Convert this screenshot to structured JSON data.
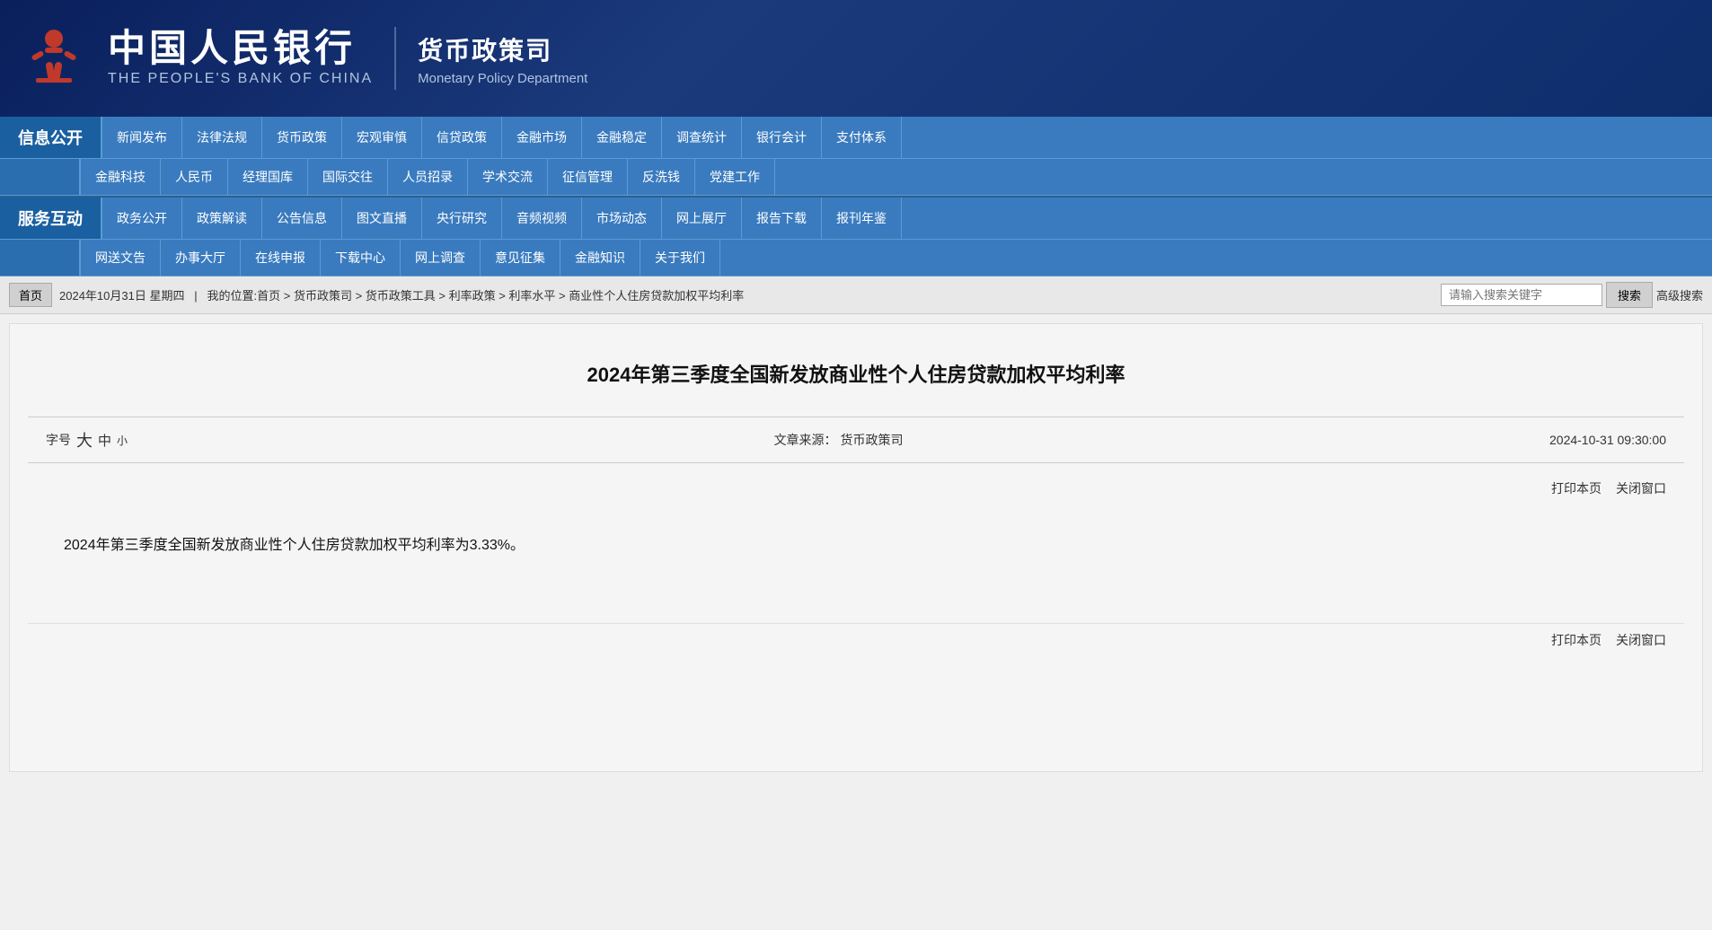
{
  "header": {
    "logo_chinese": "中国人民银行",
    "logo_english": "THE PEOPLE'S BANK OF CHINA",
    "dept_chinese": "货币政策司",
    "dept_english": "Monetary Policy Department"
  },
  "nav": {
    "row1": {
      "section_label": "信息公开",
      "items": [
        "新闻发布",
        "法律法规",
        "货币政策",
        "宏观审慎",
        "信贷政策",
        "金融市场",
        "金融稳定",
        "调查统计",
        "银行会计",
        "支付体系"
      ]
    },
    "row2": {
      "items": [
        "金融科技",
        "人民币",
        "经理国库",
        "国际交往",
        "人员招录",
        "学术交流",
        "征信管理",
        "反洗钱",
        "党建工作"
      ]
    },
    "row3": {
      "section_label": "服务互动",
      "items": [
        "政务公开",
        "政策解读",
        "公告信息",
        "图文直播",
        "央行研究",
        "音频视频",
        "市场动态",
        "网上展厅",
        "报告下载",
        "报刊年鉴"
      ]
    },
    "row4": {
      "items": [
        "网送文告",
        "办事大厅",
        "在线申报",
        "下载中心",
        "网上调查",
        "意见征集",
        "金融知识",
        "关于我们"
      ]
    }
  },
  "breadcrumb": {
    "home_btn": "首页",
    "date_text": "2024年10月31日 星期四",
    "path": "我的位置:首页 > 货币政策司 > 货币政策工具 > 利率政策 > 利率水平 > 商业性个人住房贷款加权平均利率",
    "search_placeholder": "请输入搜索关键字",
    "search_btn": "搜索",
    "advanced_search": "高级搜索"
  },
  "article": {
    "title": "2024年第三季度全国新发放商业性个人住房贷款加权平均利率",
    "font_label": "字号",
    "font_large": "大",
    "font_medium": "中",
    "font_small": "小",
    "source_label": "文章来源：",
    "source_value": "货币政策司",
    "date": "2024-10-31 09:30:00",
    "print_link": "打印本页",
    "close_link": "关闭窗口",
    "body": "2024年第三季度全国新发放商业性个人住房贷款加权平均利率为3.33%。"
  }
}
